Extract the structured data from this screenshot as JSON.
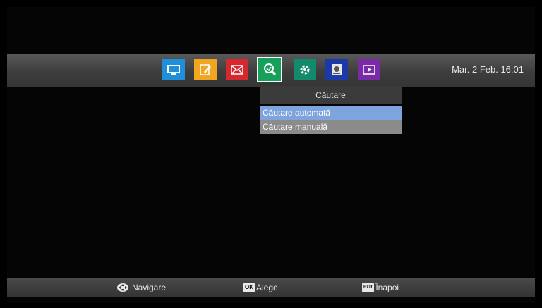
{
  "topbar": {
    "icons": [
      {
        "name": "tv-icon",
        "color": "#1e8fd8"
      },
      {
        "name": "edit-icon",
        "color": "#f2a51f"
      },
      {
        "name": "mail-icon",
        "color": "#d6282d"
      },
      {
        "name": "search-icon",
        "color": "#16a05a"
      },
      {
        "name": "settings-icon",
        "color": "#138a6b"
      },
      {
        "name": "storage-icon",
        "color": "#1b3aa8"
      },
      {
        "name": "media-icon",
        "color": "#7a2aa6"
      }
    ],
    "datetime": "Mar. 2 Feb. 16:01"
  },
  "menu": {
    "title": "Căutare",
    "items": [
      "Căutare automată",
      "Căutare manuală"
    ]
  },
  "footer": {
    "navigate": "Navigare",
    "ok_key": "OK",
    "ok_label": "Alege",
    "exit_key": "EXIT",
    "exit_label": "Înapoi"
  }
}
